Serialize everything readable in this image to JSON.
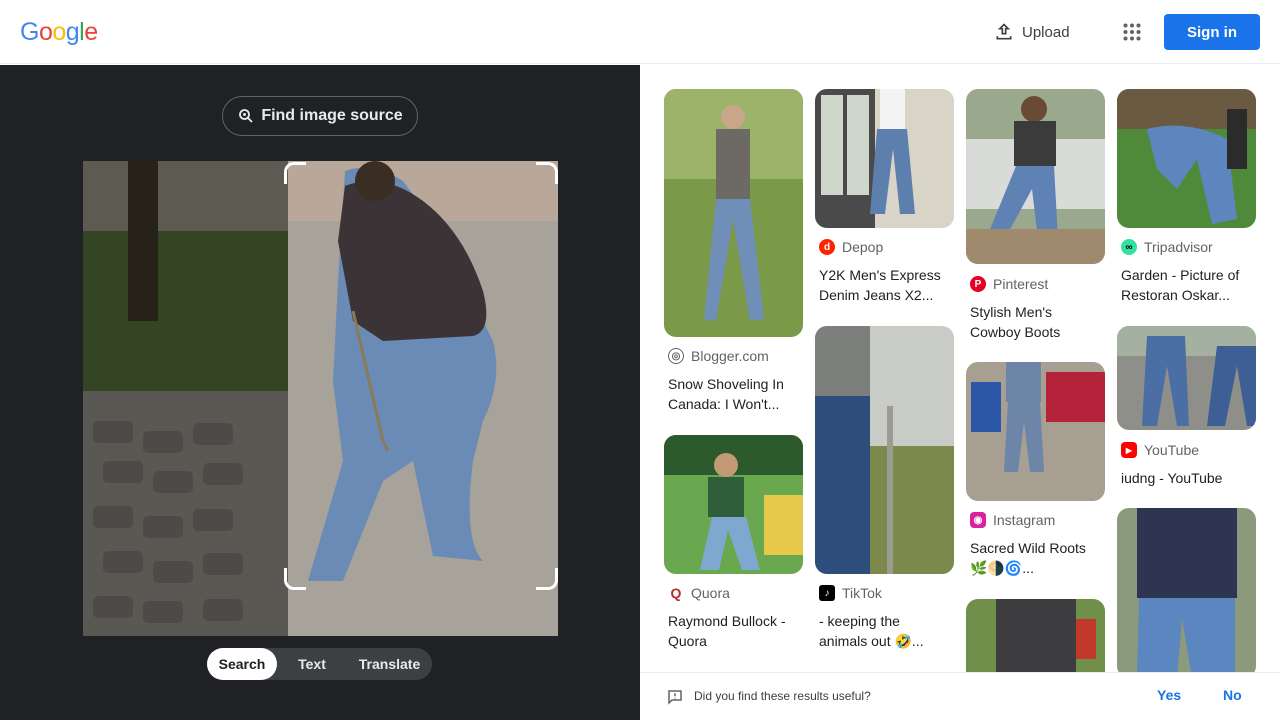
{
  "header": {
    "logo_letters": [
      "G",
      "o",
      "o",
      "g",
      "l",
      "e"
    ],
    "upload_label": "Upload",
    "signin_label": "Sign in"
  },
  "left": {
    "find_source_label": "Find image source",
    "modes": [
      {
        "label": "Search",
        "active": true
      },
      {
        "label": "Text",
        "active": false
      },
      {
        "label": "Translate",
        "active": false
      }
    ]
  },
  "results": [
    {
      "source": "Blogger.com",
      "title": "Snow Shoveling In Canada: I Won't...",
      "icon": "blogger-globe-icon"
    },
    {
      "source": "Quora",
      "title": "Raymond Bullock - Quora",
      "icon": "quora-icon"
    },
    {
      "source": "Depop",
      "title": "Y2K Men's Express Denim Jeans X2...",
      "icon": "depop-icon"
    },
    {
      "source": "TikTok",
      "title": "- keeping the animals out 🤣...",
      "icon": "tiktok-icon"
    },
    {
      "source": "Pinterest",
      "title": "Stylish Men's Cowboy Boots",
      "icon": "pinterest-icon"
    },
    {
      "source": "Instagram",
      "title": "Sacred Wild Roots 🌿🌗🌀...",
      "icon": "instagram-icon"
    },
    {
      "source": "Tripadvisor",
      "title": "Garden - Picture of Restoran Oskar...",
      "icon": "tripadvisor-icon"
    },
    {
      "source": "YouTube",
      "title": "iudng - YouTube",
      "icon": "youtube-icon"
    }
  ],
  "feedback": {
    "question": "Did you find these results useful?",
    "yes_label": "Yes",
    "no_label": "No"
  },
  "colors": {
    "accent": "#1a73e8",
    "dark_panel": "#202124"
  }
}
